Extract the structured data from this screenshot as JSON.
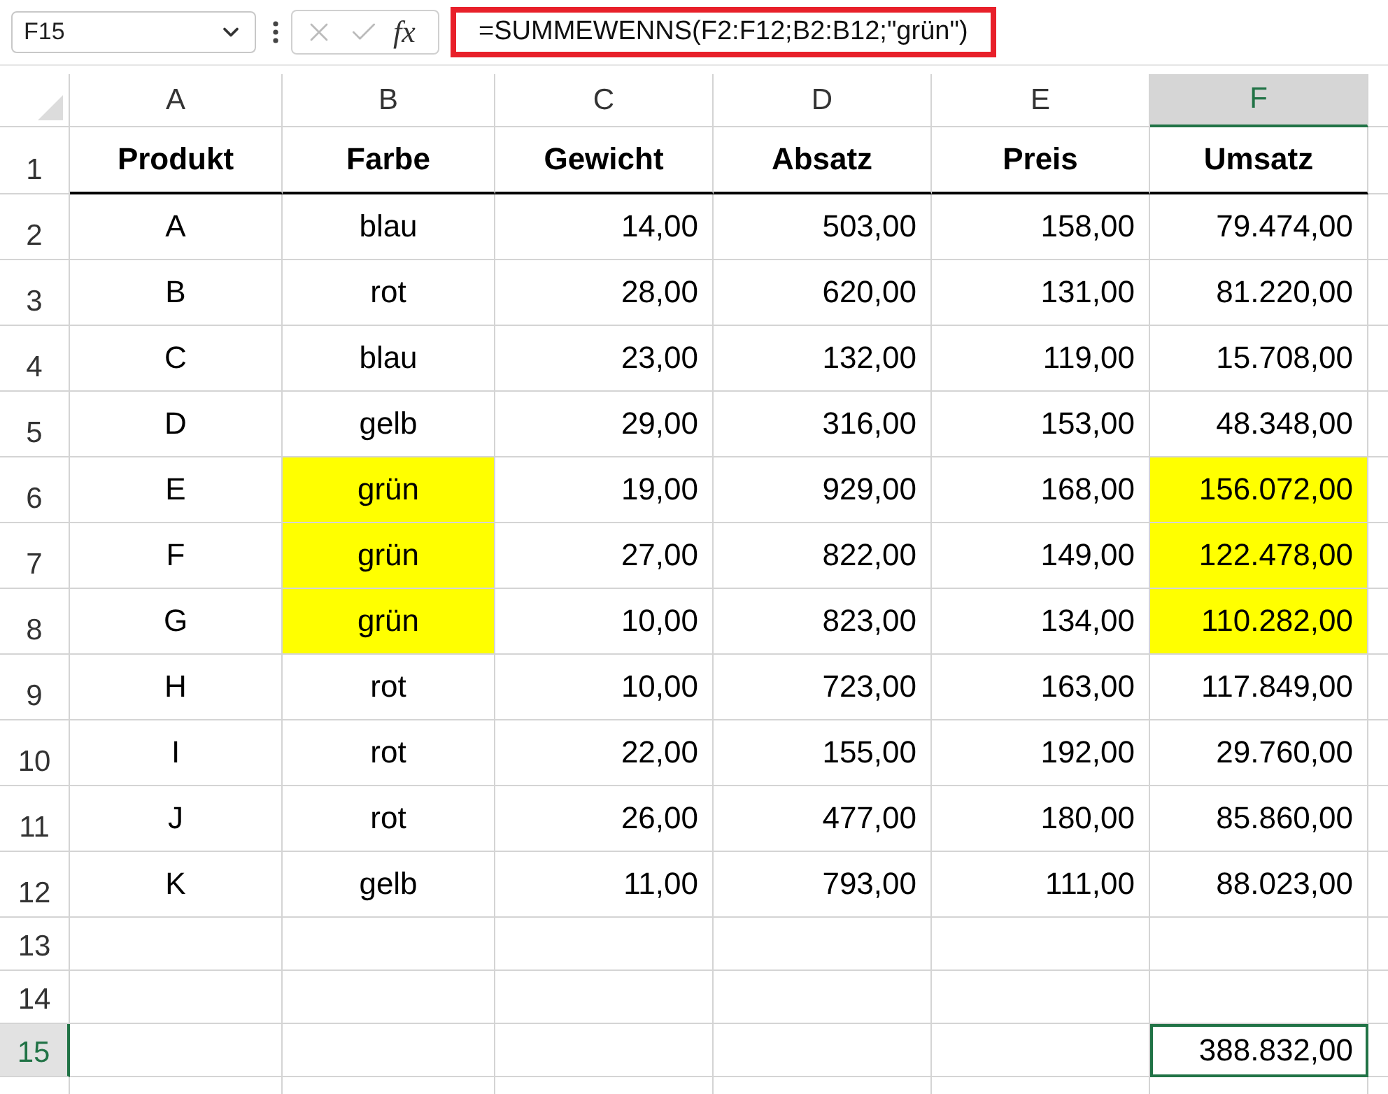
{
  "name_box": {
    "value": "F15"
  },
  "formula_bar": {
    "function_label": "fx",
    "formula": "=SUMMEWENNS(F2:F12;B2:B12;\"grün\")",
    "highlighted": true
  },
  "columns": [
    {
      "label": "A",
      "selected": false
    },
    {
      "label": "B",
      "selected": false
    },
    {
      "label": "C",
      "selected": false
    },
    {
      "label": "D",
      "selected": false
    },
    {
      "label": "E",
      "selected": false
    },
    {
      "label": "F",
      "selected": true
    }
  ],
  "rows": [
    {
      "label": "1",
      "selected": false,
      "kind": "header",
      "cells": [
        {
          "text": "Produkt",
          "highlighted": false,
          "selected": false
        },
        {
          "text": "Farbe",
          "highlighted": false,
          "selected": false
        },
        {
          "text": "Gewicht",
          "highlighted": false,
          "selected": false
        },
        {
          "text": "Absatz",
          "highlighted": false,
          "selected": false
        },
        {
          "text": "Preis",
          "highlighted": false,
          "selected": false
        },
        {
          "text": "Umsatz",
          "highlighted": false,
          "selected": false
        }
      ]
    },
    {
      "label": "2",
      "selected": false,
      "kind": "data",
      "cells": [
        {
          "text": "A",
          "highlighted": false,
          "selected": false
        },
        {
          "text": "blau",
          "highlighted": false,
          "selected": false
        },
        {
          "text": "14,00",
          "highlighted": false,
          "selected": false
        },
        {
          "text": "503,00",
          "highlighted": false,
          "selected": false
        },
        {
          "text": "158,00",
          "highlighted": false,
          "selected": false
        },
        {
          "text": "79.474,00",
          "highlighted": false,
          "selected": false
        }
      ]
    },
    {
      "label": "3",
      "selected": false,
      "kind": "data",
      "cells": [
        {
          "text": "B",
          "highlighted": false,
          "selected": false
        },
        {
          "text": "rot",
          "highlighted": false,
          "selected": false
        },
        {
          "text": "28,00",
          "highlighted": false,
          "selected": false
        },
        {
          "text": "620,00",
          "highlighted": false,
          "selected": false
        },
        {
          "text": "131,00",
          "highlighted": false,
          "selected": false
        },
        {
          "text": "81.220,00",
          "highlighted": false,
          "selected": false
        }
      ]
    },
    {
      "label": "4",
      "selected": false,
      "kind": "data",
      "cells": [
        {
          "text": "C",
          "highlighted": false,
          "selected": false
        },
        {
          "text": "blau",
          "highlighted": false,
          "selected": false
        },
        {
          "text": "23,00",
          "highlighted": false,
          "selected": false
        },
        {
          "text": "132,00",
          "highlighted": false,
          "selected": false
        },
        {
          "text": "119,00",
          "highlighted": false,
          "selected": false
        },
        {
          "text": "15.708,00",
          "highlighted": false,
          "selected": false
        }
      ]
    },
    {
      "label": "5",
      "selected": false,
      "kind": "data",
      "cells": [
        {
          "text": "D",
          "highlighted": false,
          "selected": false
        },
        {
          "text": "gelb",
          "highlighted": false,
          "selected": false
        },
        {
          "text": "29,00",
          "highlighted": false,
          "selected": false
        },
        {
          "text": "316,00",
          "highlighted": false,
          "selected": false
        },
        {
          "text": "153,00",
          "highlighted": false,
          "selected": false
        },
        {
          "text": "48.348,00",
          "highlighted": false,
          "selected": false
        }
      ]
    },
    {
      "label": "6",
      "selected": false,
      "kind": "data",
      "cells": [
        {
          "text": "E",
          "highlighted": false,
          "selected": false
        },
        {
          "text": "grün",
          "highlighted": true,
          "selected": false
        },
        {
          "text": "19,00",
          "highlighted": false,
          "selected": false
        },
        {
          "text": "929,00",
          "highlighted": false,
          "selected": false
        },
        {
          "text": "168,00",
          "highlighted": false,
          "selected": false
        },
        {
          "text": "156.072,00",
          "highlighted": true,
          "selected": false
        }
      ]
    },
    {
      "label": "7",
      "selected": false,
      "kind": "data",
      "cells": [
        {
          "text": "F",
          "highlighted": false,
          "selected": false
        },
        {
          "text": "grün",
          "highlighted": true,
          "selected": false
        },
        {
          "text": "27,00",
          "highlighted": false,
          "selected": false
        },
        {
          "text": "822,00",
          "highlighted": false,
          "selected": false
        },
        {
          "text": "149,00",
          "highlighted": false,
          "selected": false
        },
        {
          "text": "122.478,00",
          "highlighted": true,
          "selected": false
        }
      ]
    },
    {
      "label": "8",
      "selected": false,
      "kind": "data",
      "cells": [
        {
          "text": "G",
          "highlighted": false,
          "selected": false
        },
        {
          "text": "grün",
          "highlighted": true,
          "selected": false
        },
        {
          "text": "10,00",
          "highlighted": false,
          "selected": false
        },
        {
          "text": "823,00",
          "highlighted": false,
          "selected": false
        },
        {
          "text": "134,00",
          "highlighted": false,
          "selected": false
        },
        {
          "text": "110.282,00",
          "highlighted": true,
          "selected": false
        }
      ]
    },
    {
      "label": "9",
      "selected": false,
      "kind": "data",
      "cells": [
        {
          "text": "H",
          "highlighted": false,
          "selected": false
        },
        {
          "text": "rot",
          "highlighted": false,
          "selected": false
        },
        {
          "text": "10,00",
          "highlighted": false,
          "selected": false
        },
        {
          "text": "723,00",
          "highlighted": false,
          "selected": false
        },
        {
          "text": "163,00",
          "highlighted": false,
          "selected": false
        },
        {
          "text": "117.849,00",
          "highlighted": false,
          "selected": false
        }
      ]
    },
    {
      "label": "10",
      "selected": false,
      "kind": "data",
      "cells": [
        {
          "text": "I",
          "highlighted": false,
          "selected": false
        },
        {
          "text": "rot",
          "highlighted": false,
          "selected": false
        },
        {
          "text": "22,00",
          "highlighted": false,
          "selected": false
        },
        {
          "text": "155,00",
          "highlighted": false,
          "selected": false
        },
        {
          "text": "192,00",
          "highlighted": false,
          "selected": false
        },
        {
          "text": "29.760,00",
          "highlighted": false,
          "selected": false
        }
      ]
    },
    {
      "label": "11",
      "selected": false,
      "kind": "data",
      "cells": [
        {
          "text": "J",
          "highlighted": false,
          "selected": false
        },
        {
          "text": "rot",
          "highlighted": false,
          "selected": false
        },
        {
          "text": "26,00",
          "highlighted": false,
          "selected": false
        },
        {
          "text": "477,00",
          "highlighted": false,
          "selected": false
        },
        {
          "text": "180,00",
          "highlighted": false,
          "selected": false
        },
        {
          "text": "85.860,00",
          "highlighted": false,
          "selected": false
        }
      ]
    },
    {
      "label": "12",
      "selected": false,
      "kind": "data",
      "cells": [
        {
          "text": "K",
          "highlighted": false,
          "selected": false
        },
        {
          "text": "gelb",
          "highlighted": false,
          "selected": false
        },
        {
          "text": "11,00",
          "highlighted": false,
          "selected": false
        },
        {
          "text": "793,00",
          "highlighted": false,
          "selected": false
        },
        {
          "text": "111,00",
          "highlighted": false,
          "selected": false
        },
        {
          "text": "88.023,00",
          "highlighted": false,
          "selected": false
        }
      ]
    },
    {
      "label": "13",
      "selected": false,
      "kind": "empty"
    },
    {
      "label": "14",
      "selected": false,
      "kind": "empty"
    },
    {
      "label": "15",
      "selected": true,
      "kind": "empty",
      "cells": [
        null,
        null,
        null,
        null,
        null,
        {
          "text": "388.832,00",
          "highlighted": false,
          "selected": true
        }
      ]
    }
  ]
}
